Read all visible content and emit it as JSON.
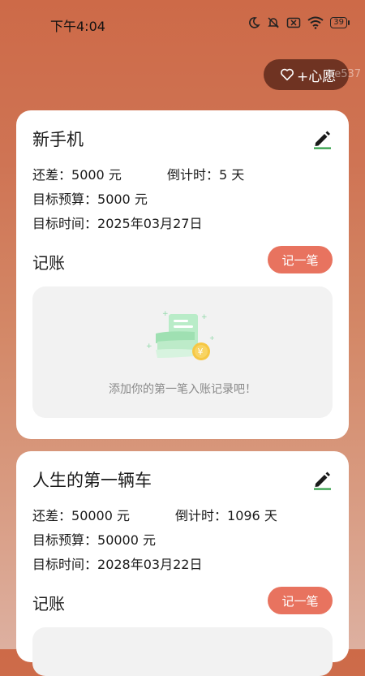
{
  "status_bar": {
    "time": "下午4:04",
    "battery": "39"
  },
  "wish_button": {
    "label": "+心愿",
    "ghost_text": "be537"
  },
  "wishes": [
    {
      "title": "新手机",
      "gap_label": "还差：",
      "gap_value": "5000 元",
      "countdown_label": "倒计时：",
      "countdown_value": "5 天",
      "budget_label": "目标预算：",
      "budget_value": "5000 元",
      "date_label": "目标时间：",
      "date_value": "2025年03月27日",
      "ledger_title": "记账",
      "record_button": "记一笔",
      "empty_text": "添加你的第一笔入账记录吧！"
    },
    {
      "title": "人生的第一辆车",
      "gap_label": "还差：",
      "gap_value": "50000 元",
      "countdown_label": "倒计时：",
      "countdown_value": "1096 天",
      "budget_label": "目标预算：",
      "budget_value": "50000 元",
      "date_label": "目标时间：",
      "date_value": "2028年03月22日",
      "ledger_title": "记账",
      "record_button": "记一笔"
    }
  ],
  "colors": {
    "accent": "#e8735f",
    "wish_button": "#6f3322",
    "card": "#ffffff"
  }
}
